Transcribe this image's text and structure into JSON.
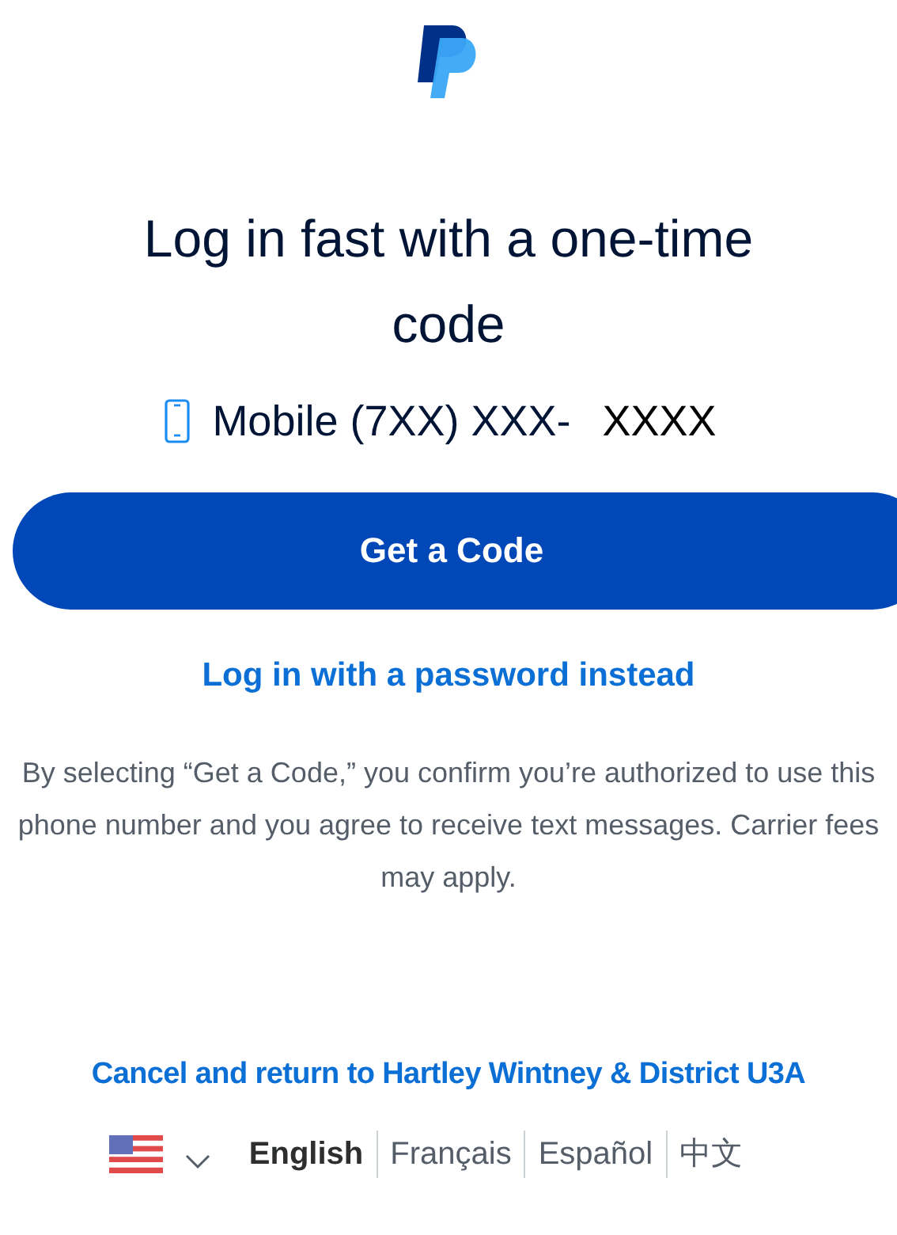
{
  "heading": "Log in fast with a one-time code",
  "phone": {
    "label": "Mobile (7XX) XXX-",
    "suffix": "XXXX"
  },
  "primary_button": "Get a Code",
  "password_link": "Log in with a password instead",
  "consent": "By selecting “Get a Code,” you confirm you’re authorized to use this phone number and you agree to receive text messages. Carrier fees may apply.",
  "cancel_link": "Cancel and return to Hartley Wintney & District U3A",
  "languages": [
    {
      "label": "English",
      "selected": true
    },
    {
      "label": "Français",
      "selected": false
    },
    {
      "label": "Español",
      "selected": false
    },
    {
      "label": "中文",
      "selected": false
    }
  ]
}
